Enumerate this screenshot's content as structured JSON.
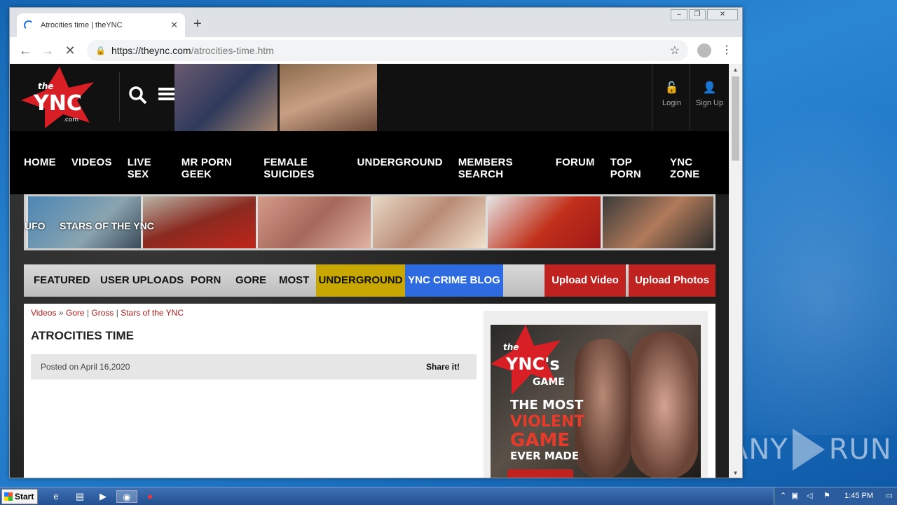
{
  "browser": {
    "tab_title": "Atrocities time | theYNC",
    "new_tab": "+",
    "url_host": "https://theync.com",
    "url_path": "/atrocities-time.htm"
  },
  "site": {
    "logo_text": "YNC",
    "logo_small": "the",
    "logo_com": ".com",
    "login_label": "Login",
    "signup_label": "Sign Up",
    "nav": [
      "HOME",
      "VIDEOS",
      "LIVE SEX",
      "MR PORN GEEK",
      "FEMALE SUICIDES",
      "UNDERGROUND",
      "MEMBERS SEARCH",
      "FORUM",
      "TOP PORN",
      "YNC ZONE"
    ],
    "subnav": [
      "UFO",
      "STARS OF THE YNC"
    ],
    "tabs": [
      "FEATURED",
      "USER UPLOADS",
      "PORN",
      "GORE",
      "MOST",
      "UNDERGROUND",
      "YNC CRIME BLOG"
    ],
    "upload_video": "Upload Video",
    "upload_photos": "Upload Photos"
  },
  "article": {
    "crumbs": [
      "Videos",
      "Gore",
      "Gross",
      "Stars of the YNC"
    ],
    "crumb_sep1": "»",
    "crumb_sep": "|",
    "title": "ATROCITIES TIME",
    "posted": "Posted on April 16,2020",
    "share": "Share it!"
  },
  "ad": {
    "brand": "YNC's",
    "brand_small": "the",
    "game": "GAME",
    "line1": "THE MOST",
    "line2": "VIOLENT",
    "line3": "GAME",
    "line4": "EVER MADE"
  },
  "taskbar": {
    "start": "Start",
    "clock": "1:45 PM"
  },
  "watermark": {
    "left": "ANY",
    "right": "RUN"
  },
  "colors": {
    "accent_red": "#c0221f",
    "underground": "#c8a800",
    "blog_blue": "#2f6be0"
  }
}
